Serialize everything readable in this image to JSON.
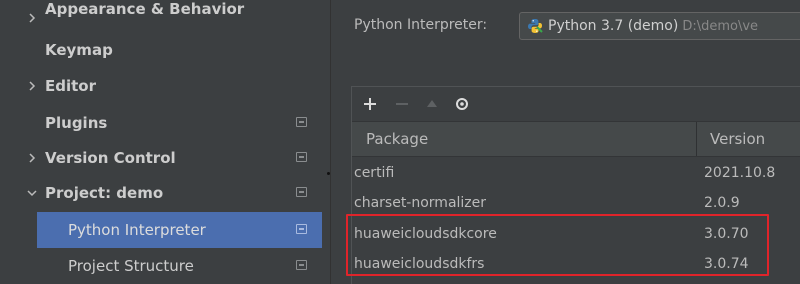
{
  "sidebar": {
    "items": [
      {
        "label": "Appearance & Behavior",
        "chevron": "right",
        "project_icon": false
      },
      {
        "label": "Keymap",
        "chevron": null,
        "project_icon": false
      },
      {
        "label": "Editor",
        "chevron": "right",
        "project_icon": false
      },
      {
        "label": "Plugins",
        "chevron": null,
        "project_icon": true
      },
      {
        "label": "Version Control",
        "chevron": "right",
        "project_icon": true
      },
      {
        "label": "Project: demo",
        "chevron": "down",
        "project_icon": true
      },
      {
        "label": "Python Interpreter",
        "chevron": null,
        "project_icon": true,
        "selected": true
      },
      {
        "label": "Project Structure",
        "chevron": null,
        "project_icon": true
      }
    ]
  },
  "interpreter": {
    "label": "Python Interpreter:",
    "name": "Python 3.7 (demo)",
    "path": "D:\\demo\\ve"
  },
  "toolbar": {
    "icons": [
      "plus-icon",
      "minus-icon",
      "upgrade-icon",
      "eye-icon"
    ]
  },
  "packages": {
    "columns": [
      "Package",
      "Version"
    ],
    "rows": [
      {
        "name": "certifi",
        "version": "2021.10.8"
      },
      {
        "name": "charset-normalizer",
        "version": "2.0.9"
      },
      {
        "name": "huaweicloudsdkcore",
        "version": "3.0.70"
      },
      {
        "name": "huaweicloudsdkfrs",
        "version": "3.0.74"
      }
    ]
  },
  "colors": {
    "background": "#3c3f41",
    "selection": "#4b6eaf",
    "highlight_border": "#e0242a",
    "header_bg": "#45494a"
  }
}
